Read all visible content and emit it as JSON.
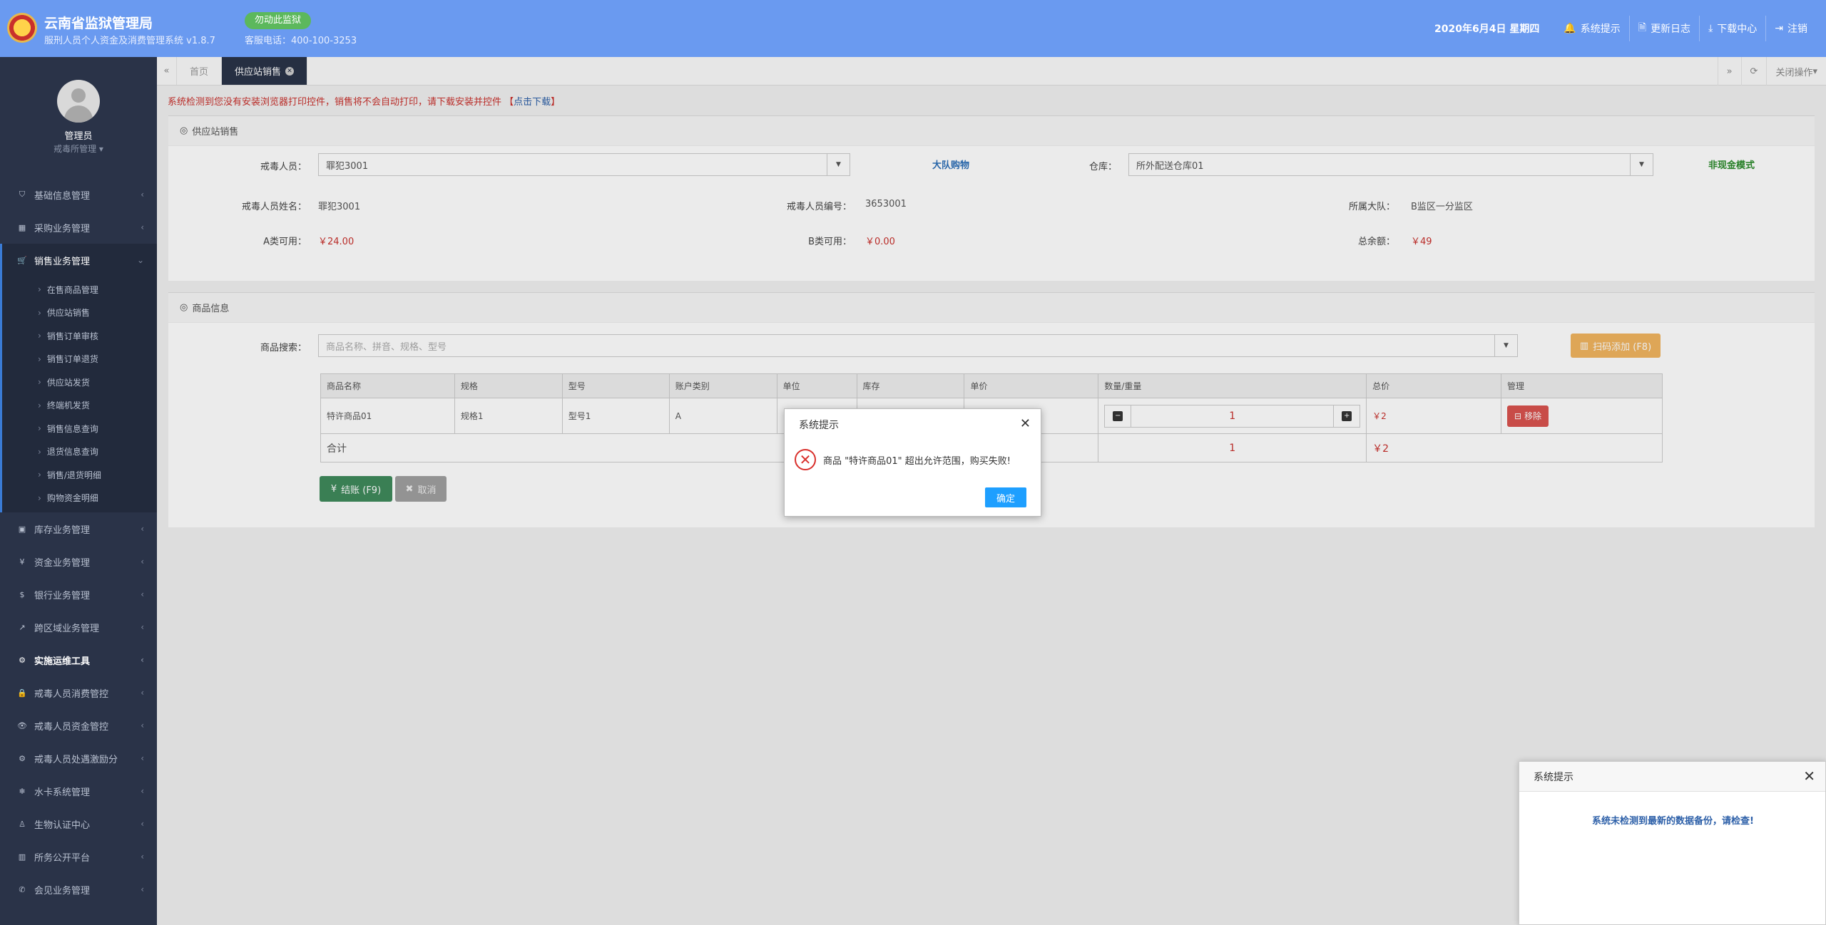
{
  "header": {
    "title": "云南省监狱管理局",
    "subtitle": "服刑人员个人资金及消费管理系统 v1.8.7",
    "badge": "勿动此监狱",
    "hotline": "客服电话：400-100-3253",
    "date": "2020年6月4日  星期四",
    "items": [
      {
        "icon": "bell-icon",
        "label": "系统提示"
      },
      {
        "icon": "file-icon",
        "label": "更新日志"
      },
      {
        "icon": "download-icon",
        "label": "下载中心"
      },
      {
        "icon": "logout-icon",
        "label": "注销"
      }
    ]
  },
  "user": {
    "name": "管理员",
    "role": "戒毒所管理"
  },
  "nav": {
    "before": [
      {
        "icon": "shield-icon",
        "label": "基础信息管理"
      },
      {
        "icon": "calendar-icon",
        "label": "采购业务管理"
      }
    ],
    "active": {
      "icon": "cart-icon",
      "label": "销售业务管理"
    },
    "sub": [
      "在售商品管理",
      "供应站销售",
      "销售订单审核",
      "销售订单退货",
      "供应站发货",
      "终端机发货",
      "销售信息查询",
      "退货信息查询",
      "销售/退货明细",
      "购物资金明细"
    ],
    "after": [
      {
        "icon": "box-icon",
        "label": "库存业务管理",
        "bold": false
      },
      {
        "icon": "yen-icon",
        "label": "资金业务管理",
        "bold": false
      },
      {
        "icon": "dollar-icon",
        "label": "银行业务管理",
        "bold": false
      },
      {
        "icon": "external-link-icon",
        "label": "跨区域业务管理",
        "bold": false
      },
      {
        "icon": "tool-icon",
        "label": "实施运维工具",
        "bold": true
      },
      {
        "icon": "lock-icon",
        "label": "戒毒人员消费管控",
        "bold": false
      },
      {
        "icon": "eye-icon",
        "label": "戒毒人员资金管控",
        "bold": false
      },
      {
        "icon": "gear-icon",
        "label": "戒毒人员处遇激励分",
        "bold": false
      },
      {
        "icon": "snowflake-icon",
        "label": "水卡系统管理",
        "bold": false
      },
      {
        "icon": "user-icon",
        "label": "生物认证中心",
        "bold": false
      },
      {
        "icon": "building-icon",
        "label": "所务公开平台",
        "bold": false
      },
      {
        "icon": "phone-icon",
        "label": "会见业务管理",
        "bold": false
      }
    ]
  },
  "tabs": {
    "home": "首页",
    "current": "供应站销售",
    "close_ops": "关闭操作"
  },
  "warning": {
    "text": "系统检测到您没有安装浏览器打印控件，销售将不会自动打印，请下载安装并控件 【",
    "link": "点击下载",
    "end": "】"
  },
  "sales": {
    "heading": "供应站销售",
    "person_label": "戒毒人员：",
    "person_value": "罪犯3001",
    "group_buy": "大队购物",
    "warehouse_label": "仓库：",
    "warehouse_value": "所外配送仓库01",
    "mode": "非现金模式",
    "name_label": "戒毒人员姓名：",
    "name_value": "罪犯3001",
    "id_label": "戒毒人员编号：",
    "id_value": "3653001",
    "team_label": "所属大队：",
    "team_value": "B监区一分监区",
    "a_label": "A类可用：",
    "a_value": "￥24.00",
    "b_label": "B类可用：",
    "b_value": "￥0.00",
    "total_label": "总余额：",
    "total_value": "￥49"
  },
  "goods": {
    "heading": "商品信息",
    "search_label": "商品搜索：",
    "search_placeholder": "商品名称、拼音、规格、型号",
    "scan_button": "扫码添加 (F8)",
    "columns": [
      "商品名称",
      "规格",
      "型号",
      "账户类别",
      "单位",
      "库存",
      "单价",
      "数量/重量",
      "总价",
      "管理"
    ],
    "row": {
      "name": "特许商品01",
      "spec": "规格1",
      "model": "型号1",
      "account": "A",
      "unit": "",
      "stock": "",
      "price": "",
      "qty": "1",
      "total": "￥2",
      "remove": "移除"
    },
    "total_label": "合计",
    "total_qty": "1",
    "total_sum": "￥2",
    "checkout": "结账 (F9)",
    "cancel": "取消"
  },
  "dialog": {
    "title": "系统提示",
    "message": "商品 \"特许商品01\" 超出允许范围，购买失败!",
    "ok": "确定"
  },
  "notice": {
    "title": "系统提示",
    "message": "系统未检测到最新的数据备份，请检查!"
  },
  "colors": {
    "header": "#6a9af0",
    "sidebar": "#2a3348",
    "danger": "#d9534f",
    "ok": "#1e9fff",
    "checkout": "#3f8a5c"
  }
}
